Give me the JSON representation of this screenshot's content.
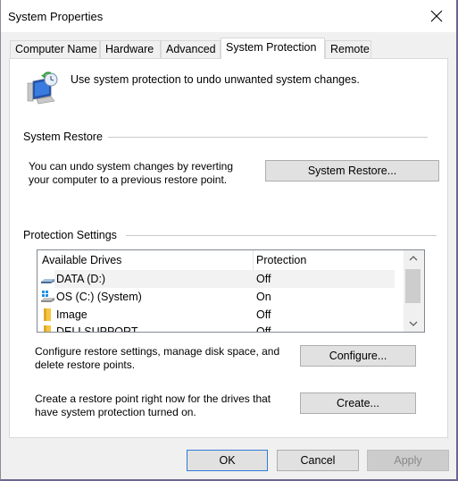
{
  "window": {
    "title": "System Properties"
  },
  "tabs": [
    {
      "label": "Computer Name",
      "active": false
    },
    {
      "label": "Hardware",
      "active": false
    },
    {
      "label": "Advanced",
      "active": false
    },
    {
      "label": "System Protection",
      "active": true
    },
    {
      "label": "Remote",
      "active": false
    }
  ],
  "intro": {
    "icon": "system-protection-icon",
    "text": "Use system protection to undo unwanted system changes."
  },
  "system_restore": {
    "group_label": "System Restore",
    "description_line1": "You can undo system changes by reverting",
    "description_line2": "your computer to a previous restore point.",
    "button_label": "System Restore..."
  },
  "protection_settings": {
    "group_label": "Protection Settings",
    "columns": [
      "Available Drives",
      "Protection"
    ],
    "drives": [
      {
        "name": "DATA (D:)",
        "protection": "Off",
        "icon": "drive-icon",
        "selected": true
      },
      {
        "name": "OS (C:) (System)",
        "protection": "On",
        "icon": "system-drive-icon",
        "selected": false
      },
      {
        "name": "Image",
        "protection": "Off",
        "icon": "folder-icon",
        "selected": false
      },
      {
        "name": "DELLSUPPORT",
        "protection": "Off",
        "icon": "folder-icon",
        "selected": false
      }
    ],
    "configure_line1": "Configure restore settings, manage disk space, and",
    "configure_line2": "delete restore points.",
    "configure_button": "Configure...",
    "create_line1": "Create a restore point right now for the drives that",
    "create_line2": "have system protection turned on.",
    "create_button": "Create..."
  },
  "footer": {
    "ok": "OK",
    "cancel": "Cancel",
    "apply": "Apply"
  }
}
